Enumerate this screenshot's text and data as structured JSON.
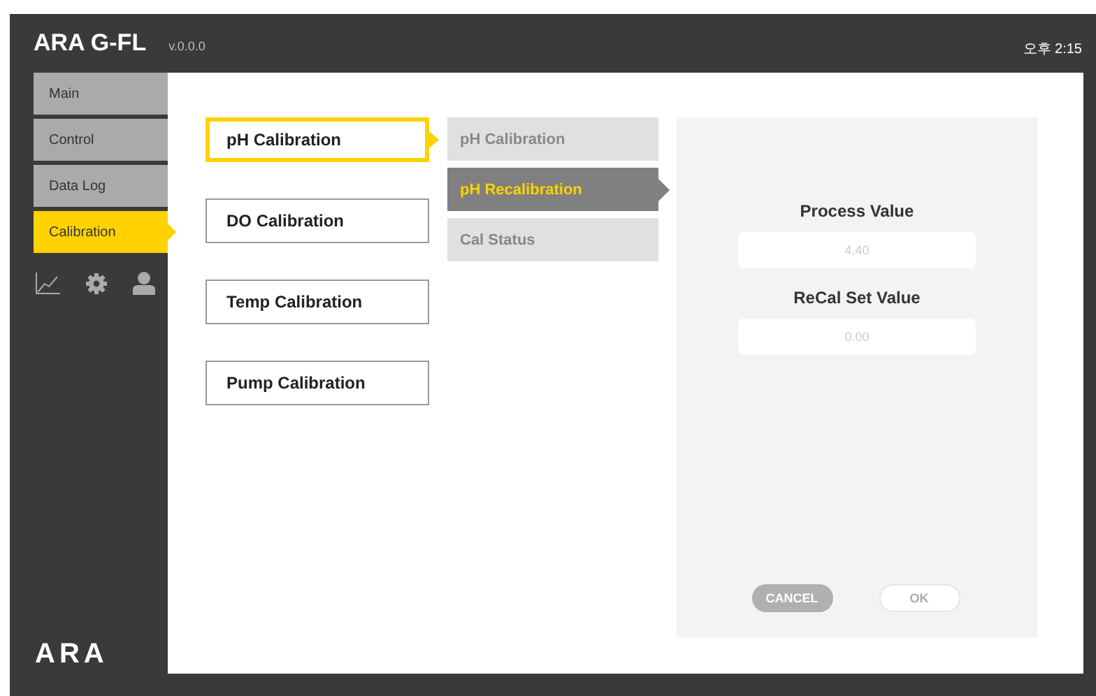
{
  "header": {
    "title": "ARA G-FL",
    "version": "v.0.0.0",
    "time": "오후 2:15"
  },
  "nav": [
    {
      "label": "Main",
      "selected": false
    },
    {
      "label": "Control",
      "selected": false
    },
    {
      "label": "Data Log",
      "selected": false
    },
    {
      "label": "Calibration",
      "selected": true
    }
  ],
  "footer_logo": "ARA",
  "calibrations": [
    {
      "label": "pH Calibration",
      "selected": true
    },
    {
      "label": "DO Calibration",
      "selected": false
    },
    {
      "label": "Temp Calibration",
      "selected": false
    },
    {
      "label": "Pump Calibration",
      "selected": false
    }
  ],
  "submenu": [
    {
      "label": "pH Calibration",
      "selected": false
    },
    {
      "label": "pH Recalibration",
      "selected": true
    },
    {
      "label": "Cal Status",
      "selected": false
    }
  ],
  "fields": [
    {
      "label": "Process Value",
      "value": "4.40"
    },
    {
      "label": "ReCal Set Value",
      "value": "0.00"
    }
  ],
  "buttons": [
    {
      "label": "CANCEL",
      "kind": "cancel"
    },
    {
      "label": "OK",
      "kind": "ok"
    }
  ]
}
